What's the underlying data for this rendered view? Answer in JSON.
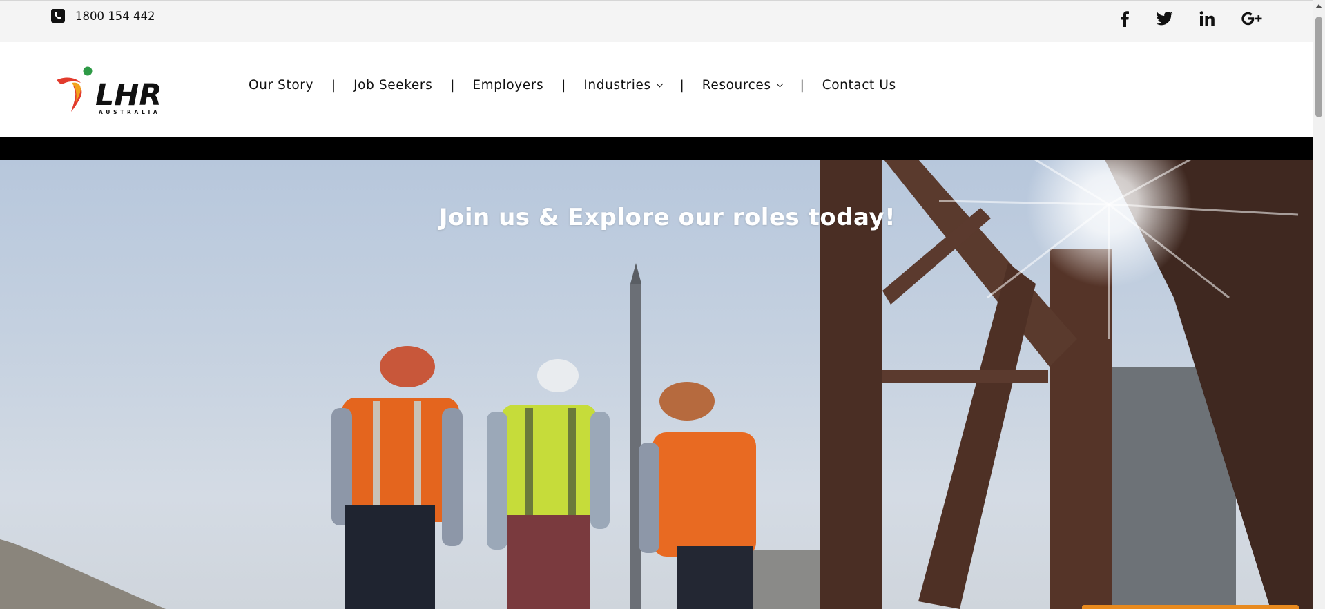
{
  "topbar": {
    "phone_icon": "phone-square-icon",
    "phone_number": "1800 154 442",
    "social": [
      {
        "name": "facebook-icon",
        "glyph": "f"
      },
      {
        "name": "twitter-icon",
        "glyph": "bird"
      },
      {
        "name": "linkedin-icon",
        "glyph": "in"
      },
      {
        "name": "google-plus-icon",
        "glyph": "G+"
      }
    ]
  },
  "header": {
    "logo": {
      "text": "LHR",
      "subtext": "AUSTRALIA",
      "colors": [
        "#e23b2d",
        "#f2a21c",
        "#2e9a46"
      ]
    },
    "nav": [
      {
        "label": "Our Story",
        "dropdown": false
      },
      {
        "label": "Job Seekers",
        "dropdown": false
      },
      {
        "label": "Employers",
        "dropdown": false
      },
      {
        "label": "Industries",
        "dropdown": true
      },
      {
        "label": "Resources",
        "dropdown": true
      },
      {
        "label": "Contact Us",
        "dropdown": false
      }
    ],
    "separator": "|"
  },
  "hero": {
    "title": "Join us & Explore our roles today!"
  },
  "colors": {
    "topbar_bg": "#f4f4f4",
    "hero_title": "#ffffff",
    "accent_orange": "#e88a1e"
  }
}
